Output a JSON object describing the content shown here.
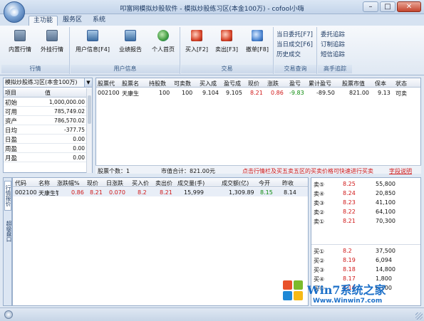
{
  "window": {
    "title": "叩富网模拟炒股软件 - 模拟炒股练习区(本金100万) - cofool小嗨",
    "minimize": "–",
    "maximize": "□",
    "close": "✕"
  },
  "tabs": [
    "主功能",
    "服务区",
    "系统"
  ],
  "ribbon": {
    "groups": [
      {
        "label": "行情",
        "buttons": [
          "内置行情",
          "外挂行情"
        ]
      },
      {
        "label": "用户信息",
        "buttons": [
          "用户信息[F4]",
          "业绩报告",
          "个人首页"
        ]
      },
      {
        "label": "交易",
        "buttons": [
          "买入[F2]",
          "卖出[F3]",
          "撤单[F8]"
        ]
      },
      {
        "label": "交易查询",
        "links": [
          "当日委托[F7]",
          "当日成交[F6]",
          "历史成交"
        ]
      },
      {
        "label": "高手追踪",
        "links": [
          "委托追踪",
          "订制追踪",
          "短信追踪",
          "高手追踪"
        ]
      }
    ]
  },
  "account": {
    "selected": "模拟炒股练习区(本金100万)",
    "headers": [
      "项目",
      "值"
    ],
    "rows": [
      {
        "k": "初始",
        "v": "1,000,000.00"
      },
      {
        "k": "可用",
        "v": "785,749.02"
      },
      {
        "k": "资产",
        "v": "786,570.02"
      },
      {
        "k": "日均",
        "v": "-377.75"
      },
      {
        "k": "日盈",
        "v": "0.00"
      },
      {
        "k": "周盈",
        "v": "0.00"
      },
      {
        "k": "月盈",
        "v": "0.00"
      }
    ]
  },
  "positions": {
    "headers": [
      "股票代",
      "股票名",
      "持股数",
      "可卖数",
      "买入成",
      "盈亏成",
      "现价",
      "涨跌",
      "盈亏",
      "累计盈亏",
      "股票市值",
      "保本",
      "状态"
    ],
    "rows": [
      [
        "002100",
        "天康生",
        "100",
        "100",
        "9.104",
        "9.105",
        "8.21",
        "0.86",
        "-9.83",
        "-89.50",
        "821.00",
        "9.13",
        "可卖"
      ]
    ],
    "summary": {
      "count_label": "股票个数：1",
      "value_label": "市值合计：821.00元",
      "hint": "点击行情栏及买五卖五区的买卖价格可快速进行买卖",
      "link": "字段说明"
    }
  },
  "quote": {
    "side_tabs": [
      "行情报价",
      "超级盘口"
    ],
    "headers": [
      "代码",
      "名称",
      "涨跌幅%",
      "现价",
      "日涨跌",
      "买入价",
      "卖出价",
      "成交量(手)",
      "成交额(亿)",
      "今开",
      "昨收"
    ],
    "rows": [
      [
        "002100",
        "天康生钅",
        "0.86",
        "8.21",
        "0.070",
        "8.2",
        "8.21",
        "15,999",
        "1,309.89",
        "8.15",
        "8.14"
      ]
    ]
  },
  "orderbook": {
    "sell": [
      {
        "label": "卖⑤",
        "price": "8.25",
        "vol": "55,800"
      },
      {
        "label": "卖④",
        "price": "8.24",
        "vol": "20,850"
      },
      {
        "label": "卖③",
        "price": "8.23",
        "vol": "41,100"
      },
      {
        "label": "卖②",
        "price": "8.22",
        "vol": "64,100"
      },
      {
        "label": "卖①",
        "price": "8.21",
        "vol": "70,300"
      }
    ],
    "buy": [
      {
        "label": "买①",
        "price": "8.2",
        "vol": "37,500"
      },
      {
        "label": "买②",
        "price": "8.19",
        "vol": "6,094"
      },
      {
        "label": "买③",
        "price": "8.18",
        "vol": "14,800"
      },
      {
        "label": "买④",
        "price": "8.17",
        "vol": "1,800"
      },
      {
        "label": "买⑤",
        "price": "8.16",
        "vol": "6,100"
      }
    ]
  },
  "watermark": {
    "title": "Win7系统之家",
    "url": "Www.Winwin7.com"
  },
  "colors": {
    "up": "#d01818",
    "down": "#0a8a0a",
    "accent": "#1d3a63"
  }
}
